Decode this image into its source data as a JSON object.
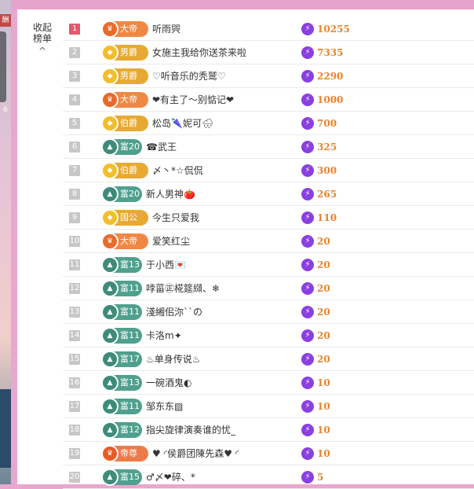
{
  "side": {
    "tag_top": "酬",
    "tag_mid": "6"
  },
  "collapse": {
    "label": "收起榜单",
    "chevron": "^"
  },
  "ranks": [
    {
      "rank": "1",
      "top": true,
      "badge": {
        "style": "orange",
        "text": "大帝"
      },
      "name": "听雨巺",
      "score": "10255"
    },
    {
      "rank": "2",
      "badge": {
        "style": "gold",
        "text": "男爵"
      },
      "name": "女施主我给你送茶来啦",
      "score": "7335"
    },
    {
      "rank": "3",
      "badge": {
        "style": "gold",
        "text": "男爵"
      },
      "name": "♡听音乐的秃鹫♡",
      "score": "2290"
    },
    {
      "rank": "4",
      "badge": {
        "style": "orange",
        "text": "大帝"
      },
      "name": "❤有主了～别惦记❤",
      "score": "1000"
    },
    {
      "rank": "5",
      "badge": {
        "style": "gold",
        "text": "伯爵"
      },
      "name": "松岛🌂妮可🌧",
      "score": "700"
    },
    {
      "rank": "6",
      "badge": {
        "style": "teal",
        "text": "富20"
      },
      "name": "☎武王",
      "score": "325"
    },
    {
      "rank": "7",
      "badge": {
        "style": "gold",
        "text": "伯爵"
      },
      "name": "〆丶*☆侃侃",
      "score": "300"
    },
    {
      "rank": "8",
      "badge": {
        "style": "teal",
        "text": "富20"
      },
      "name": "新人男神🍅",
      "score": "265"
    },
    {
      "rank": "9",
      "badge": {
        "style": "gold",
        "text": "国公"
      },
      "name": "今生只爱我",
      "score": "110"
    },
    {
      "rank": "10",
      "badge": {
        "style": "orange",
        "text": "大帝"
      },
      "name": "爱笑红尘",
      "score": "20"
    },
    {
      "rank": "11",
      "badge": {
        "style": "teal",
        "text": "富13"
      },
      "name": "于小西💌",
      "score": "20"
    },
    {
      "rank": "12",
      "badge": {
        "style": "teal",
        "text": "富11"
      },
      "name": "哱菑㊣椛筵纐、❄",
      "score": "20"
    },
    {
      "rank": "13",
      "badge": {
        "style": "teal",
        "text": "富11"
      },
      "name": "淺緗佀沵``の",
      "score": "20"
    },
    {
      "rank": "14",
      "badge": {
        "style": "teal",
        "text": "富11"
      },
      "name": "卡洛m✦",
      "score": "20"
    },
    {
      "rank": "15",
      "badge": {
        "style": "teal",
        "text": "富17"
      },
      "name": "♨单身传说♨",
      "score": "20"
    },
    {
      "rank": "16",
      "badge": {
        "style": "teal",
        "text": "富13"
      },
      "name": "一碗酒鬼◐",
      "score": "10"
    },
    {
      "rank": "17",
      "badge": {
        "style": "teal",
        "text": "富11"
      },
      "name": "邹东东▨",
      "score": "10"
    },
    {
      "rank": "18",
      "badge": {
        "style": "teal",
        "text": "富12"
      },
      "name": "指尖旋律演奏谁的忧_",
      "score": "10"
    },
    {
      "rank": "19",
      "badge": {
        "style": "emperor",
        "text": "帝尊"
      },
      "name": "♥ ◜侯爵团陳先森♥ ◜",
      "score": "10"
    },
    {
      "rank": "20",
      "badge": {
        "style": "teal",
        "text": "富15"
      },
      "name": "♂〆❤碎、*",
      "score": "5"
    }
  ],
  "colors": {
    "background": "#e9a6cf",
    "score": "#e8842c",
    "bolt": "#8a3fe0",
    "rank_top": "#e4586b",
    "rank": "#c9c6c6"
  },
  "icons": {
    "badge_orange": "crown-icon",
    "badge_gold": "shield-icon",
    "badge_teal": "triangle-icon",
    "score": "lightning-bolt-icon"
  }
}
